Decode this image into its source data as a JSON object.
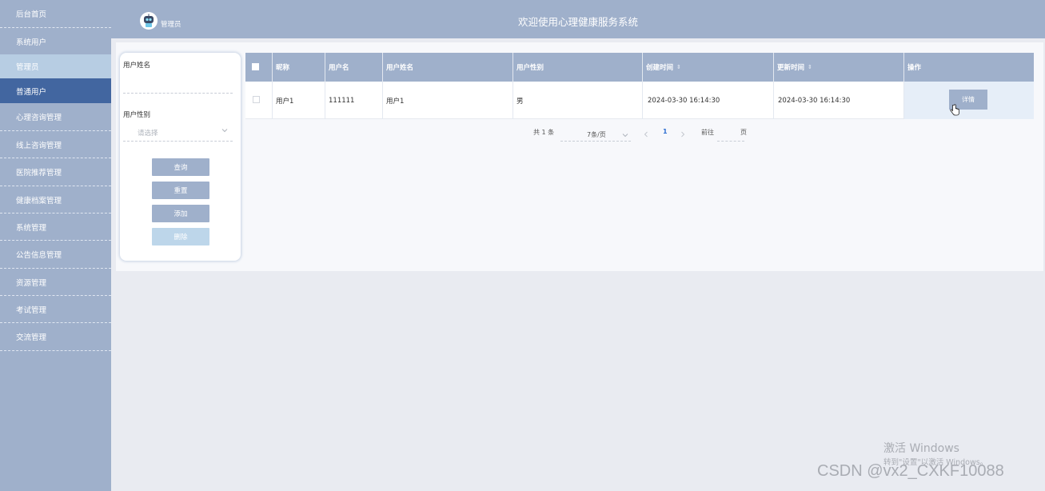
{
  "sidebar": {
    "items": [
      {
        "label": "后台首页"
      },
      {
        "label": "系统用户"
      },
      {
        "label": "管理员"
      },
      {
        "label": "普通用户"
      },
      {
        "label": "心理咨询管理"
      },
      {
        "label": "线上咨询管理"
      },
      {
        "label": "医院推荐管理"
      },
      {
        "label": "健康档案管理"
      },
      {
        "label": "系统管理"
      },
      {
        "label": "公告信息管理"
      },
      {
        "label": "资源管理"
      },
      {
        "label": "考试管理"
      },
      {
        "label": "交流管理"
      }
    ]
  },
  "header": {
    "user_role": "管理员",
    "title": "欢迎使用心理健康服务系统"
  },
  "search": {
    "name_label": "用户姓名",
    "name_value": "",
    "gender_label": "用户性别",
    "gender_placeholder": "请选择",
    "query_button": "查询",
    "reset_button": "重置",
    "add_button": "添加",
    "delete_button": "删除"
  },
  "table": {
    "columns": [
      "昵称",
      "用户名",
      "用户姓名",
      "用户性别",
      "创建时间",
      "更新时间",
      "操作"
    ],
    "rows": [
      {
        "nickname": "用户1",
        "username": "111111",
        "real_name": "用户1",
        "gender": "男",
        "created": "2024-03-30 16:14:30",
        "updated": "2024-03-30 16:14:30",
        "action": "详情"
      }
    ]
  },
  "pagination": {
    "total": "共 1 条",
    "page_size": "7条/页",
    "current_page": "1",
    "goto_prefix": "前往",
    "goto_suffix": "页"
  },
  "watermark": {
    "windows_title": "激活 Windows",
    "windows_sub": "转到\"设置\"以激活 Windows。",
    "csdn": "CSDN @vx2_CXKF10088"
  },
  "colors": {
    "sidebar_bg": "#9fb0cb",
    "active_item": "#4266a0",
    "light_item": "#b7cde3",
    "header_bg": "#9fb0cb"
  }
}
